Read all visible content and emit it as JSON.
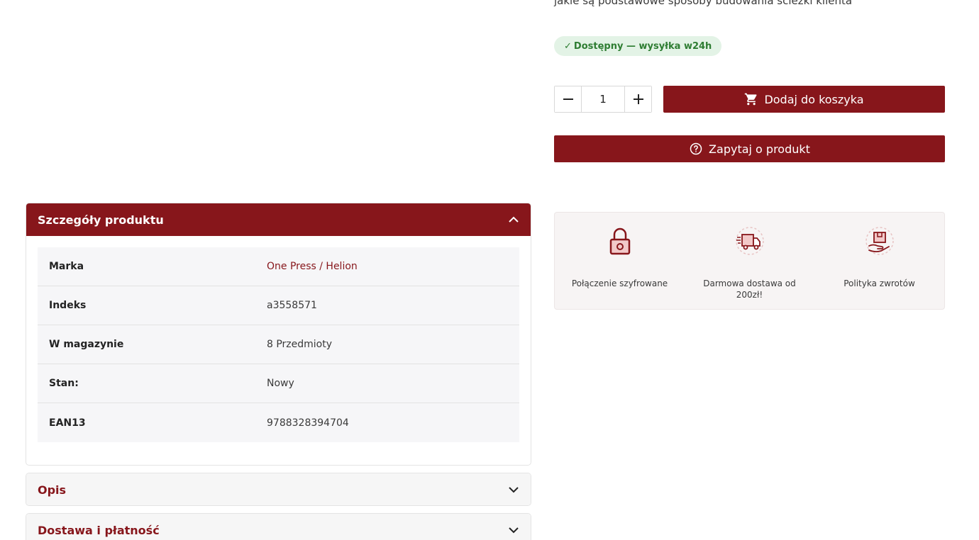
{
  "product": {
    "description_tail": "jakie są podstawowe sposoby budowania ścieżki klienta",
    "availability": {
      "check": "✓",
      "text": "Dostępny — wysyłka w24h"
    },
    "quantity": {
      "value": "1",
      "minus_icon": "minus-icon",
      "plus_icon": "plus-icon"
    },
    "add_to_cart_label": "Dodaj do koszyka",
    "ask_label": "Zapytaj o produkt"
  },
  "reassurance": [
    {
      "icon": "padlock-icon",
      "label": "Połączenie szyfrowane"
    },
    {
      "icon": "delivery-truck-icon",
      "label": "Darmowa dostawa od 200zł!"
    },
    {
      "icon": "return-box-icon",
      "label": "Polityka zwrotów"
    }
  ],
  "details": {
    "title": "Szczegóły produktu",
    "rows": [
      {
        "label": "Marka",
        "value": "One Press / Helion"
      },
      {
        "label": "Indeks",
        "value": "a3558571"
      },
      {
        "label": "W magazynie",
        "value": "8 Przedmioty"
      },
      {
        "label": "Stan:",
        "value": "Nowy"
      },
      {
        "label": "EAN13",
        "value": "9788328394704"
      }
    ]
  },
  "accordions": {
    "description_title": "Opis",
    "shipping_title": "Dostawa i płatność"
  },
  "colors": {
    "accent": "#87161b",
    "badge_bg": "#e3f3e6",
    "badge_text": "#2e7d32"
  }
}
